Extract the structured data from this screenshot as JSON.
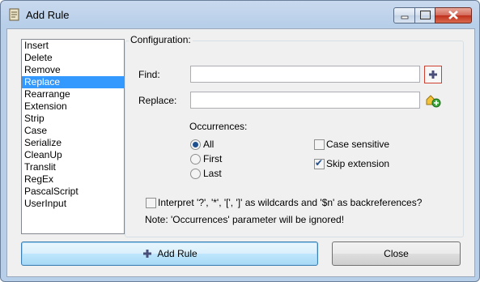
{
  "window": {
    "title": "Add Rule",
    "icon": "rule-app-icon",
    "buttons": [
      "minimize-icon",
      "maximize-icon",
      "close-icon"
    ]
  },
  "rules": {
    "items": [
      "Insert",
      "Delete",
      "Remove",
      "Replace",
      "Rearrange",
      "Extension",
      "Strip",
      "Case",
      "Serialize",
      "CleanUp",
      "Translit",
      "RegEx",
      "PascalScript",
      "UserInput"
    ],
    "selected": "Replace"
  },
  "config": {
    "group_label": "Configuration:",
    "find_label": "Find:",
    "find_value": "",
    "replace_label": "Replace:",
    "replace_value": "",
    "occurrences_label": "Occurrences:",
    "occurrences": [
      {
        "label": "All",
        "selected": true
      },
      {
        "label": "First",
        "selected": false
      },
      {
        "label": "Last",
        "selected": false
      }
    ],
    "case_sensitive_label": "Case sensitive",
    "case_sensitive": false,
    "skip_extension_label": "Skip extension",
    "skip_extension": true,
    "wildcards_label": "Interpret '?', '*', '[', ']' as wildcards and '$n' as backreferences?",
    "wildcards": false,
    "note": "Note: 'Occurrences' parameter will be ignored!"
  },
  "footer": {
    "add_rule_label": "Add Rule",
    "close_label": "Close"
  },
  "colors": {
    "selection": "#3399ff",
    "titlebar": "#b8cfe9",
    "close_button": "#c0301c"
  }
}
